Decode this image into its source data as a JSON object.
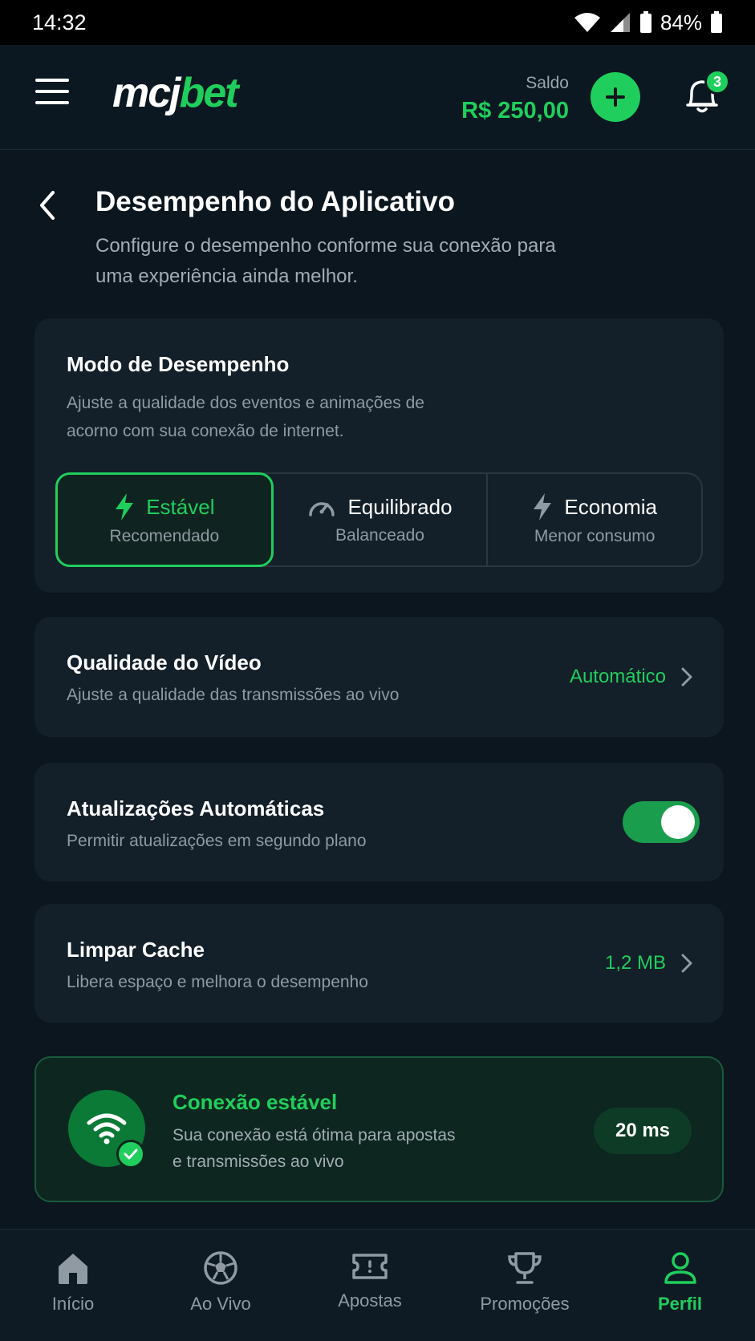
{
  "status_bar": {
    "time": "14:32",
    "battery": "84%"
  },
  "header": {
    "logo_part1": "mcj",
    "logo_part2": "bet",
    "balance_label": "Saldo",
    "balance_value": "R$ 250,00",
    "notification_count": "3"
  },
  "page": {
    "title": "Desempenho do Aplicativo",
    "subtitle": "Configure o desempenho conforme sua conexão para uma experiência ainda melhor."
  },
  "performance_mode": {
    "title": "Modo de Desempenho",
    "description": "Ajuste a qualidade dos eventos e animações de acorno com sua conexão de internet.",
    "options": [
      {
        "label": "Estável",
        "sub": "Recomendado",
        "icon": "bolt-icon",
        "selected": true
      },
      {
        "label": "Equilibrado",
        "sub": "Balanceado",
        "icon": "speedometer-icon",
        "selected": false
      },
      {
        "label": "Economia",
        "sub": "Menor consumo",
        "icon": "bolt-icon",
        "selected": false
      }
    ]
  },
  "video_quality": {
    "title": "Qualidade do Vídeo",
    "description": "Ajuste a qualidade das transmissões ao vivo",
    "value": "Automático"
  },
  "auto_updates": {
    "title": "Atualizações Automáticas",
    "description": "Permitir atualizações em segundo plano",
    "enabled": true
  },
  "clear_cache": {
    "title": "Limpar Cache",
    "description": "Libera espaço e melhora o desempenho",
    "value": "1,2 MB"
  },
  "connection": {
    "title": "Conexão estável",
    "description": "Sua conexão está ótima para apostas e transmissões ao vivo",
    "ping": "20 ms"
  },
  "bottom_nav": [
    {
      "label": "Início",
      "icon": "home-icon",
      "active": false
    },
    {
      "label": "Ao Vivo",
      "icon": "soccer-ball-icon",
      "active": false
    },
    {
      "label": "Apostas",
      "icon": "ticket-icon",
      "active": false
    },
    {
      "label": "Promoções",
      "icon": "trophy-icon",
      "active": false
    },
    {
      "label": "Perfil",
      "icon": "user-icon",
      "active": true
    }
  ],
  "colors": {
    "accent": "#1fce5c",
    "background": "#0b161f",
    "card": "#131f29"
  }
}
